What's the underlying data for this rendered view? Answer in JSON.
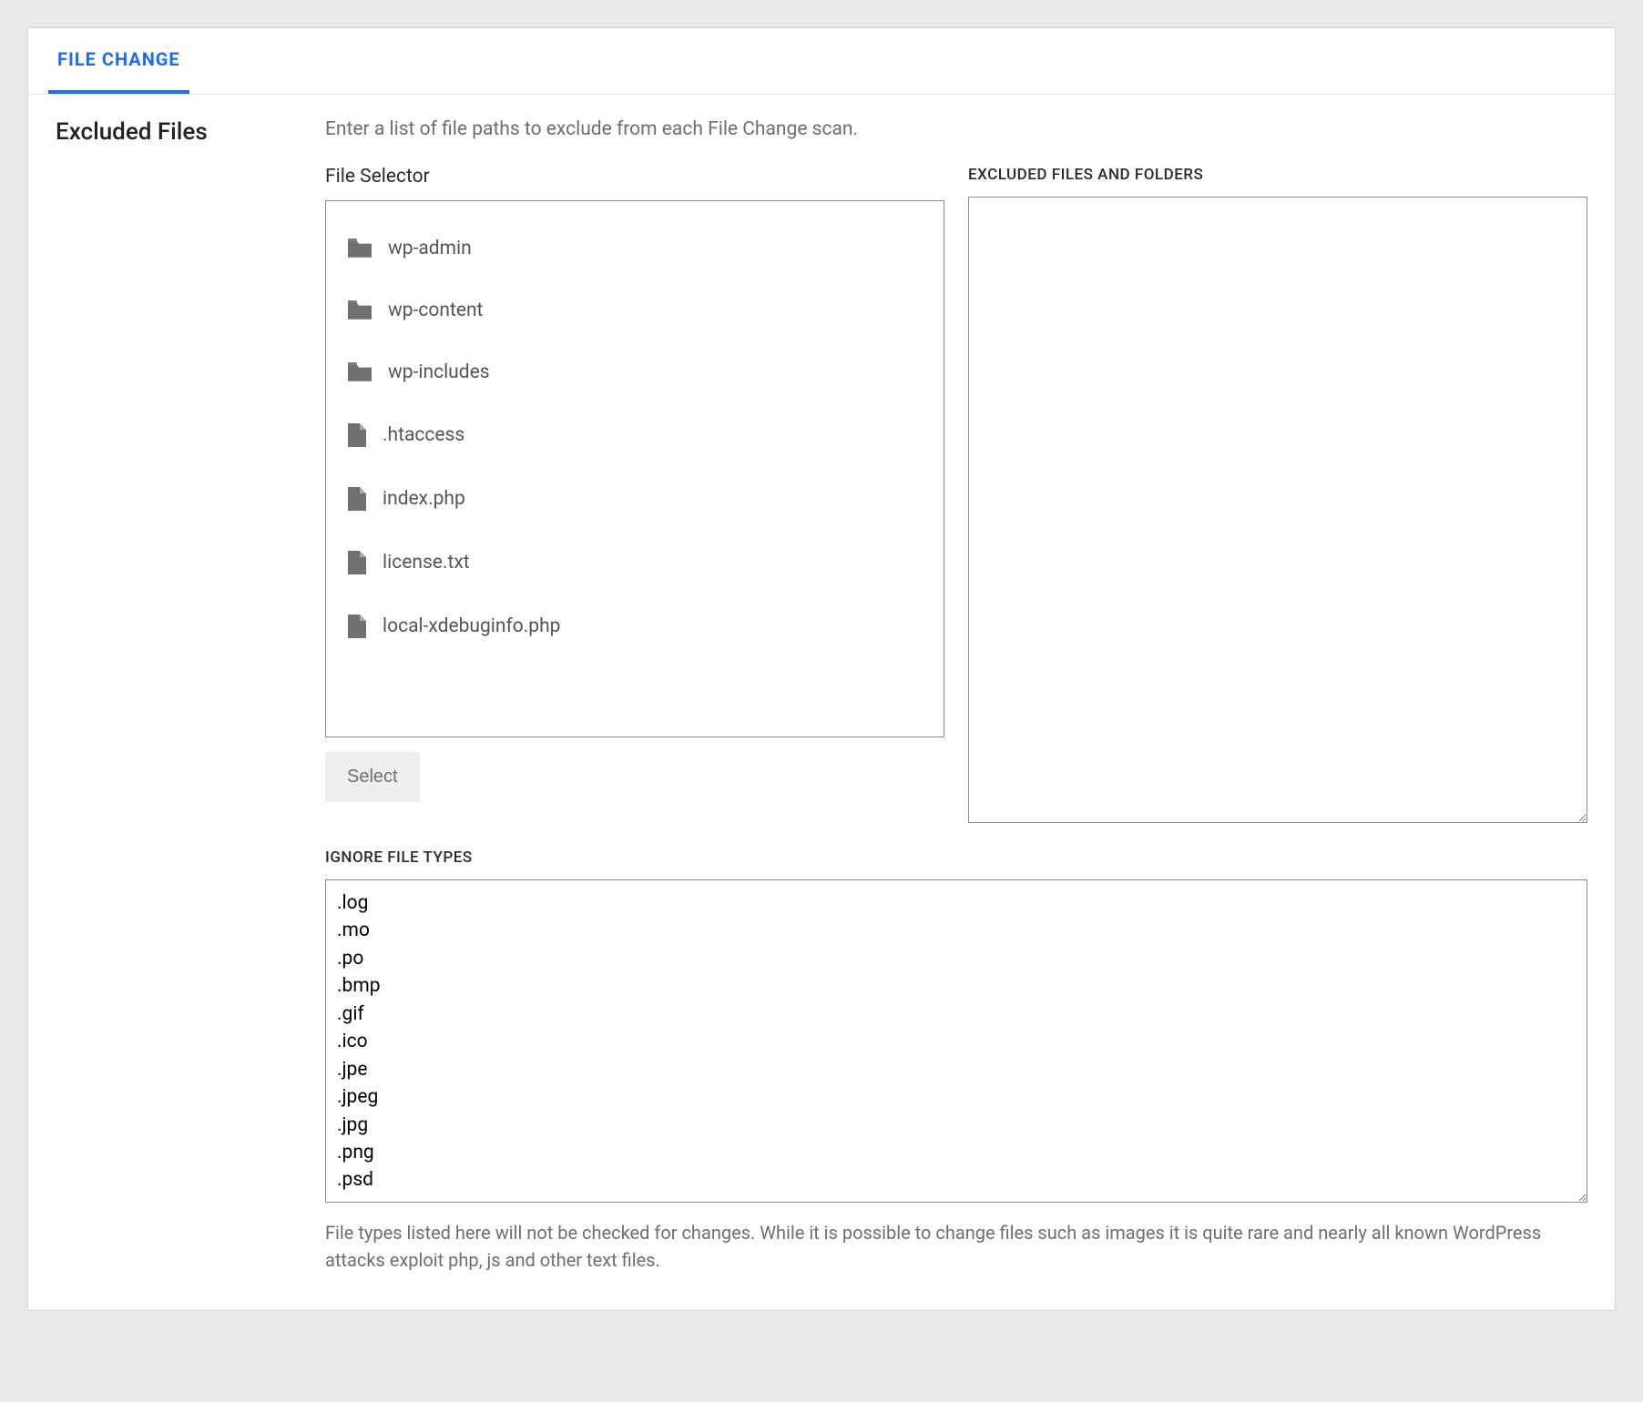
{
  "tab_label": "FILE CHANGE",
  "section_title": "Excluded Files",
  "description": "Enter a list of file paths to exclude from each File Change scan.",
  "file_selector": {
    "label": "File Selector",
    "items": [
      {
        "name": "wp-admin",
        "type": "folder"
      },
      {
        "name": "wp-content",
        "type": "folder"
      },
      {
        "name": "wp-includes",
        "type": "folder"
      },
      {
        "name": ".htaccess",
        "type": "file"
      },
      {
        "name": "index.php",
        "type": "file"
      },
      {
        "name": "license.txt",
        "type": "file"
      },
      {
        "name": "local-xdebuginfo.php",
        "type": "file"
      }
    ],
    "select_button": "Select"
  },
  "excluded": {
    "label": "EXCLUDED FILES AND FOLDERS",
    "value": ""
  },
  "ignore": {
    "label": "IGNORE FILE TYPES",
    "value": ".log\n.mo\n.po\n.bmp\n.gif\n.ico\n.jpe\n.jpeg\n.jpg\n.png\n.psd",
    "help": "File types listed here will not be checked for changes. While it is possible to change files such as images it is quite rare and nearly all known WordPress attacks exploit php, js and other text files."
  }
}
